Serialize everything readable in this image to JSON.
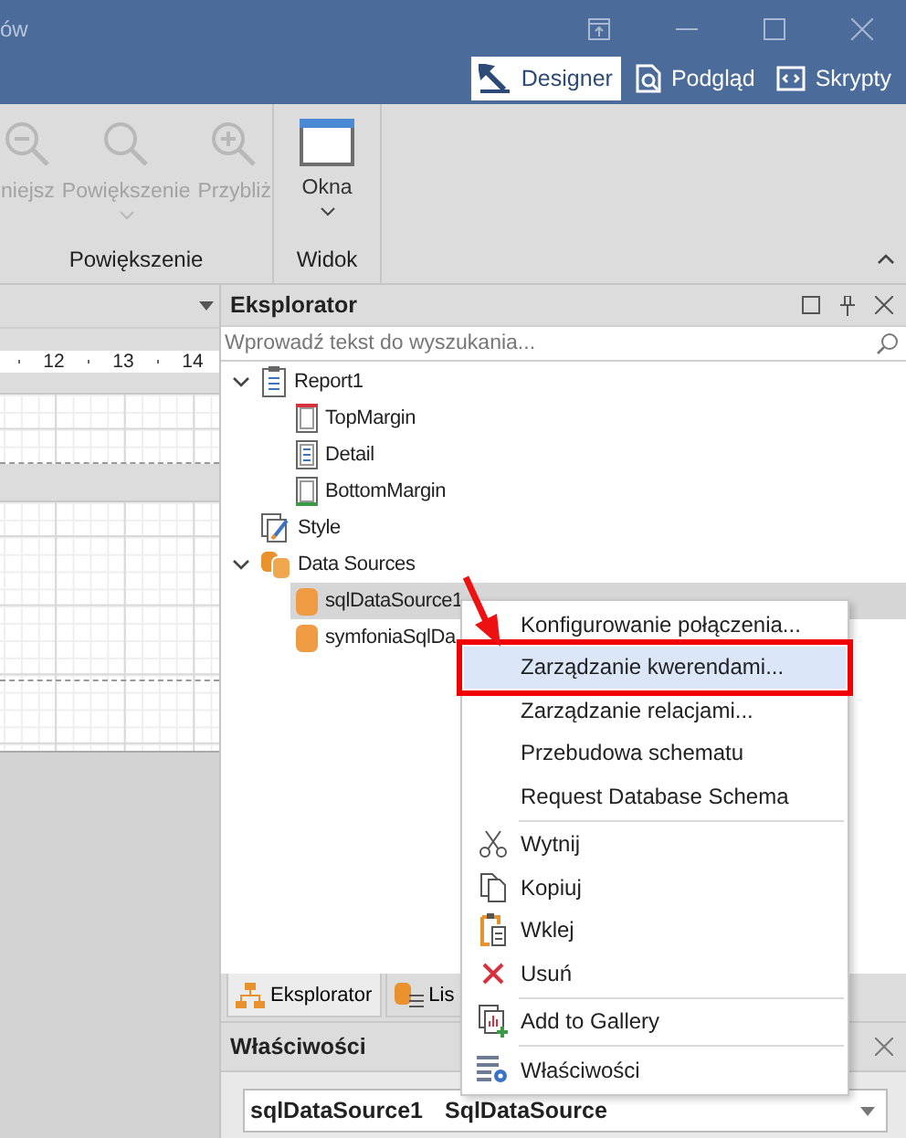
{
  "window": {
    "title": "ów",
    "view_tabs": [
      {
        "label": "Designer",
        "selected": true
      },
      {
        "label": "Podgląd",
        "selected": false
      },
      {
        "label": "Skrypty",
        "selected": false
      }
    ]
  },
  "ribbon": {
    "groups": [
      {
        "label": "Powiększenie",
        "items": [
          {
            "label": "niejsz",
            "kind": "zoom-out",
            "disabled": true,
            "dropdown": false
          },
          {
            "label": "Powiększenie",
            "kind": "zoom",
            "disabled": true,
            "dropdown": true
          },
          {
            "label": "Przybliż",
            "kind": "zoom-in",
            "disabled": true,
            "dropdown": false
          }
        ]
      },
      {
        "label": "Widok",
        "items": [
          {
            "label": "Okna",
            "kind": "window",
            "disabled": false,
            "dropdown": true
          }
        ]
      }
    ]
  },
  "design_surface": {
    "ruler": [
      "12",
      "13",
      "14"
    ]
  },
  "explorer": {
    "title": "Eksplorator",
    "search": {
      "placeholder": "Wprowadź tekst do wyszukania..."
    },
    "tree": [
      {
        "label": "Report1",
        "kind": "report",
        "expanded": true,
        "selected": false,
        "children": [
          {
            "label": "TopMargin",
            "kind": "band-top",
            "selected": false
          },
          {
            "label": "Detail",
            "kind": "band-detail",
            "selected": false
          },
          {
            "label": "BottomMargin",
            "kind": "band-bottom",
            "selected": false
          }
        ]
      },
      {
        "label": "Style",
        "kind": "style",
        "selected": false
      },
      {
        "label": "Data Sources",
        "kind": "sources",
        "expanded": true,
        "selected": false,
        "children": [
          {
            "label": "sqlDataSource1",
            "kind": "source",
            "selected": true
          },
          {
            "label": "symfoniaSqlDa",
            "kind": "source",
            "selected": false
          }
        ]
      }
    ],
    "tabs": [
      {
        "label": "Eksplorator",
        "kind": "tree",
        "selected": true
      },
      {
        "label": "Lis",
        "kind": "list",
        "selected": false
      }
    ]
  },
  "properties": {
    "title": "Właściwości",
    "selector": {
      "name": "sqlDataSource1",
      "type": "SqlDataSource"
    }
  },
  "context_menu": {
    "sections": [
      [
        {
          "label": "Konfigurowanie połączenia...",
          "kind": "plain",
          "selected": false,
          "outlined": false
        },
        {
          "label": "Zarządzanie kwerendami...",
          "kind": "plain",
          "selected": true,
          "outlined": true
        },
        {
          "label": "Zarządzanie relacjami...",
          "kind": "plain",
          "selected": false,
          "outlined": false
        },
        {
          "label": "Przebudowa schematu",
          "kind": "plain",
          "selected": false,
          "outlined": false
        },
        {
          "label": "Request Database Schema",
          "kind": "plain",
          "selected": false,
          "outlined": false
        }
      ],
      [
        {
          "label": "Wytnij",
          "kind": "cut",
          "selected": false,
          "outlined": false
        },
        {
          "label": "Kopiuj",
          "kind": "copy",
          "selected": false,
          "outlined": false
        },
        {
          "label": "Wklej",
          "kind": "paste",
          "selected": false,
          "outlined": false
        },
        {
          "label": "Usuń",
          "kind": "delete",
          "selected": false,
          "outlined": false
        }
      ],
      [
        {
          "label": "Add to Gallery",
          "kind": "gallery",
          "selected": false,
          "outlined": false
        }
      ],
      [
        {
          "label": "Właściwości",
          "kind": "properties",
          "selected": false,
          "outlined": false
        }
      ]
    ]
  }
}
